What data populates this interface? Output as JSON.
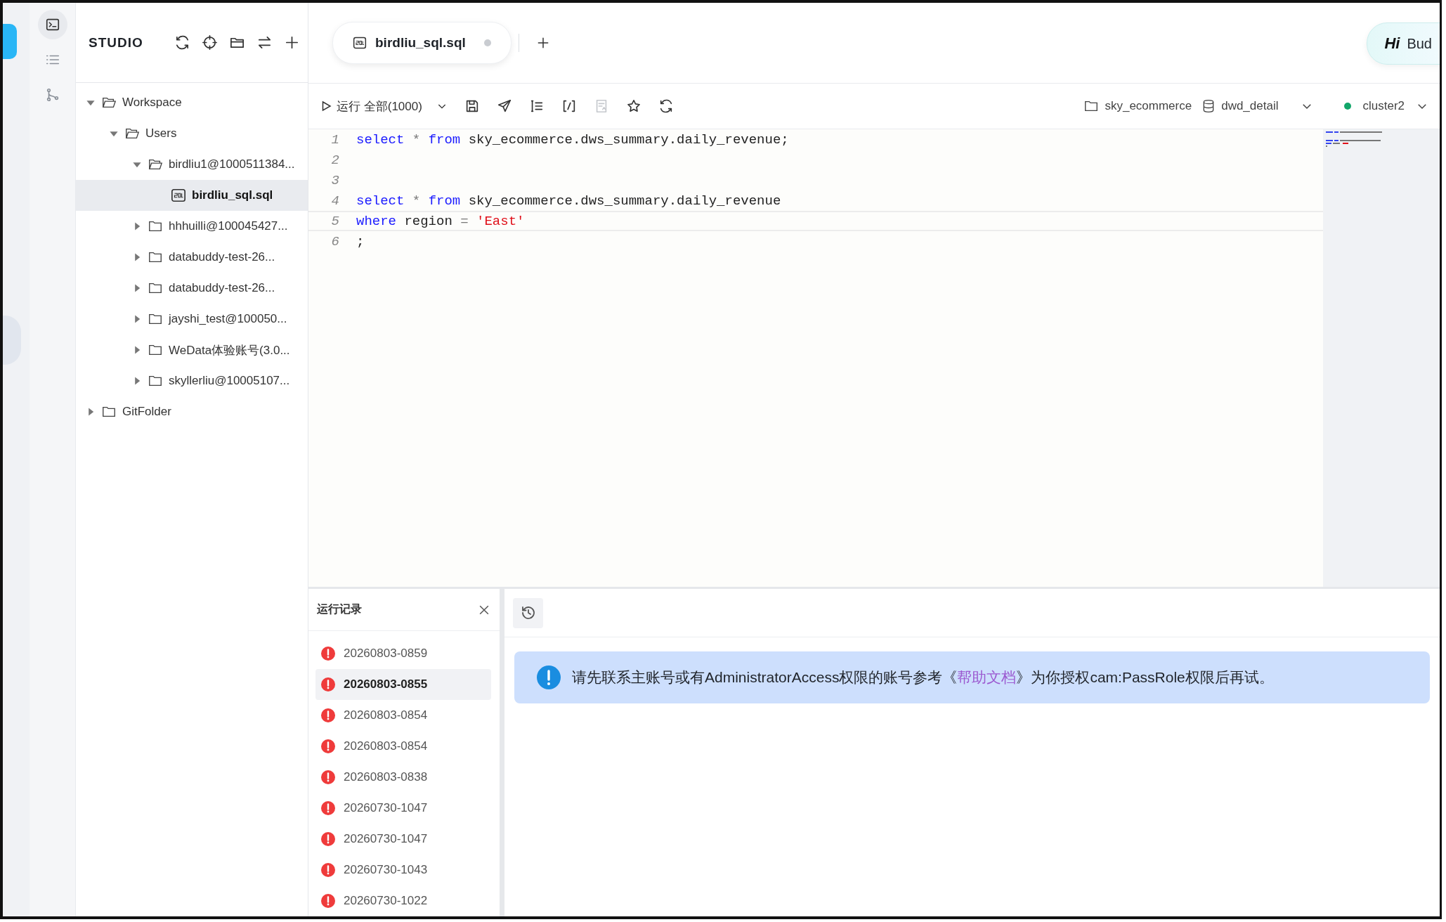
{
  "rail": {
    "items": [
      {
        "selected": true
      },
      {
        "selected": false
      },
      {
        "selected": false
      }
    ]
  },
  "sidebar": {
    "title": "STUDIO",
    "tree": [
      {
        "label": "Workspace",
        "kind": "folder",
        "expanded": true,
        "selected": false,
        "children": [
          {
            "label": "Users",
            "kind": "folder",
            "expanded": true,
            "selected": false,
            "children": [
              {
                "label": "birdliu1@1000511384...",
                "kind": "folder",
                "expanded": true,
                "selected": false,
                "children": [
                  {
                    "label": "birdliu_sql.sql",
                    "kind": "file",
                    "selected": true
                  }
                ]
              },
              {
                "label": "hhhuilli@100045427...",
                "kind": "folder",
                "expanded": false,
                "selected": false
              },
              {
                "label": "databuddy-test-26...",
                "kind": "folder",
                "expanded": false,
                "selected": false
              },
              {
                "label": "databuddy-test-26...",
                "kind": "folder",
                "expanded": false,
                "selected": false
              },
              {
                "label": "jayshi_test@100050...",
                "kind": "folder",
                "expanded": false,
                "selected": false
              },
              {
                "label": "WeData体验账号(3.0...",
                "kind": "folder",
                "expanded": false,
                "selected": false
              },
              {
                "label": "skyllerliu@10005107...",
                "kind": "folder",
                "expanded": false,
                "selected": false
              }
            ]
          }
        ]
      },
      {
        "label": "GitFolder",
        "kind": "folder",
        "expanded": false,
        "selected": false
      }
    ]
  },
  "tabs": [
    {
      "label": "birdliu_sql.sql",
      "selected": true,
      "modified": true
    }
  ],
  "assistant": {
    "logo_text": "Hi",
    "label": "Bud"
  },
  "toolbar": {
    "run_label": "运行 全部(1000)",
    "tools": [
      {
        "disabled": false
      },
      {
        "disabled": false
      },
      {
        "disabled": false
      },
      {
        "disabled": false
      },
      {
        "disabled": true
      },
      {
        "disabled": false
      },
      {
        "disabled": false
      }
    ],
    "catalog": "sky_ecommerce",
    "database": "dwd_detail",
    "cluster": {
      "name": "cluster2",
      "color": "#12a66a"
    }
  },
  "editor": {
    "lines": [
      {
        "number": "1",
        "current": false,
        "tokens": [
          {
            "kind": "keyword",
            "text": "select"
          },
          {
            "kind": "operator",
            "text": " * "
          },
          {
            "kind": "keyword",
            "text": "from"
          },
          {
            "kind": "text",
            "text": " sky_ecommerce.dws_summary.daily_revenue;"
          }
        ]
      },
      {
        "number": "2",
        "current": false
      },
      {
        "number": "3",
        "current": false
      },
      {
        "number": "4",
        "current": false,
        "tokens": [
          {
            "kind": "keyword",
            "text": "select"
          },
          {
            "kind": "operator",
            "text": " * "
          },
          {
            "kind": "keyword",
            "text": "from"
          },
          {
            "kind": "text",
            "text": " sky_ecommerce.dws_summary.daily_revenue"
          }
        ]
      },
      {
        "number": "5",
        "current": true,
        "tokens": [
          {
            "kind": "keyword",
            "text": "where"
          },
          {
            "kind": "text",
            "text": " region "
          },
          {
            "kind": "operator",
            "text": "= "
          },
          {
            "kind": "string",
            "text": "'East'"
          }
        ]
      },
      {
        "number": "6",
        "current": false,
        "tokens": [
          {
            "kind": "text",
            "text": ";"
          }
        ]
      }
    ]
  },
  "runs": {
    "title": "运行记录",
    "items": [
      {
        "label": "20260803-0859",
        "selected": false
      },
      {
        "label": "20260803-0855",
        "selected": true
      },
      {
        "label": "20260803-0854",
        "selected": false
      },
      {
        "label": "20260803-0854",
        "selected": false
      },
      {
        "label": "20260803-0838",
        "selected": false
      },
      {
        "label": "20260730-1047",
        "selected": false
      },
      {
        "label": "20260730-1047",
        "selected": false
      },
      {
        "label": "20260730-1043",
        "selected": false
      },
      {
        "label": "20260730-1022",
        "selected": false
      }
    ]
  },
  "message": {
    "before": "请先联系主账号或有AdministratorAccess权限的账号参考《",
    "link": "帮助文档",
    "after": "》为你授权cam:PassRole权限后再试。"
  }
}
